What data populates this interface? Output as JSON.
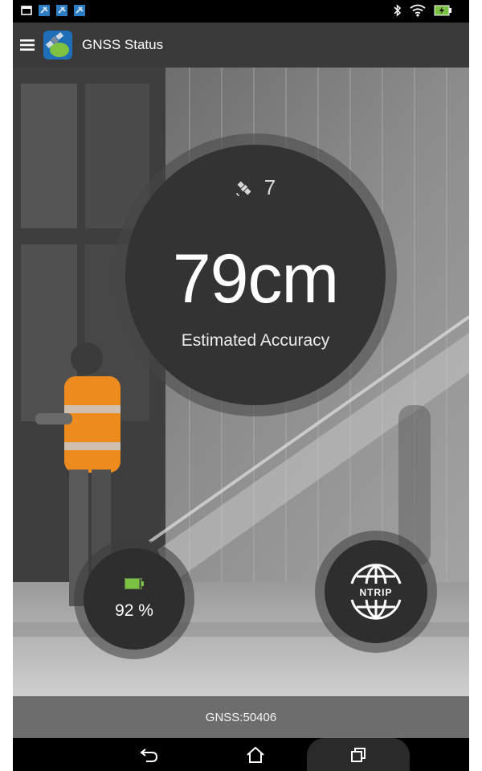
{
  "app": {
    "title": "GNSS Status"
  },
  "status_bar": {
    "left_icons": [
      "notification-icon",
      "gnss-notification-icon",
      "gnss-notification-icon",
      "gnss-notification-icon"
    ],
    "right_icons": [
      "bluetooth-icon",
      "wifi-icon",
      "battery-charging-icon"
    ]
  },
  "accuracy": {
    "satellites": "7",
    "value": "79cm",
    "label": "Estimated Accuracy"
  },
  "battery": {
    "text": "92 %",
    "level": 0.92
  },
  "ntrip": {
    "label": "NTRIP"
  },
  "footer": {
    "gnss_text": "GNSS:50406"
  },
  "colors": {
    "toolbar": "#3a3a3a",
    "circle": "#333333",
    "battery_fill": "#7bc144",
    "navbar": "#000000"
  }
}
